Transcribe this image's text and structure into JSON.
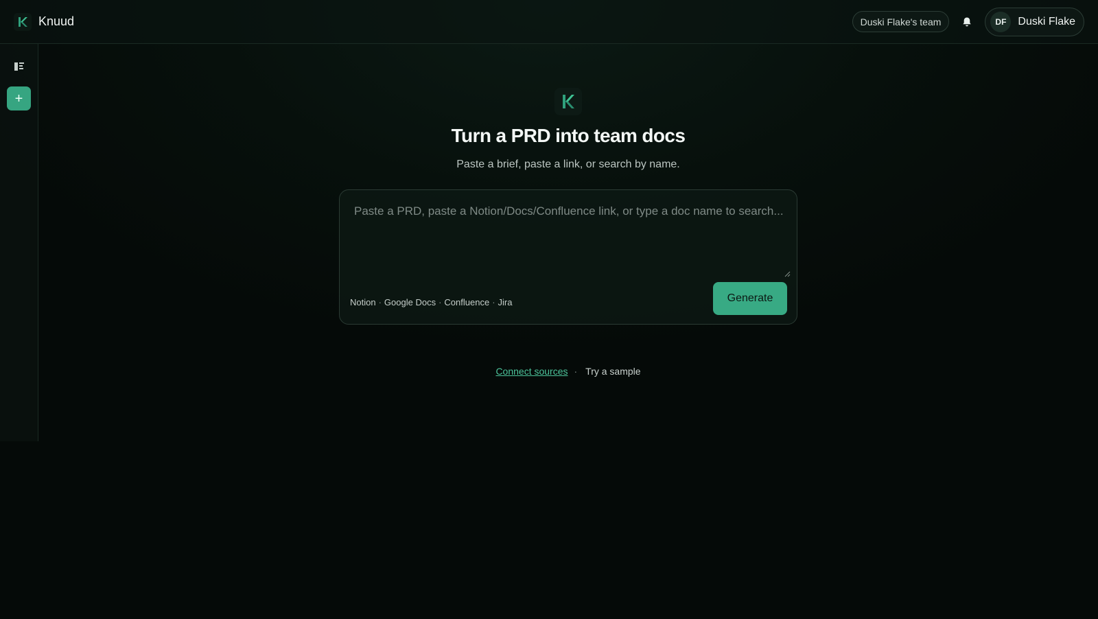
{
  "app": {
    "name": "Knuud"
  },
  "header": {
    "team_label": "Duski Flake's team",
    "user": {
      "initials": "DF",
      "name": "Duski Flake"
    }
  },
  "sidebar": {
    "new_label": "+"
  },
  "main": {
    "title": "Turn a PRD into team docs",
    "subtitle": "Paste a brief, paste a link, or search by name.",
    "input": {
      "value": "",
      "placeholder": "Paste a PRD, paste a Notion/Docs/Confluence link, or type a doc name to search..."
    },
    "sources": [
      "Notion",
      "Google Docs",
      "Confluence",
      "Jira"
    ],
    "source_separator": "·",
    "generate_label": "Generate",
    "links": {
      "connect": "Connect sources",
      "separator": "·",
      "sample": "Try a sample"
    }
  },
  "colors": {
    "accent": "#38aa84",
    "accent_link": "#4cc39a",
    "background": "#050a08"
  },
  "icons": {
    "logo": "knuud-logo-icon",
    "bell": "bell-icon",
    "sidebar_toggle": "sidebar-toggle-icon",
    "plus": "plus-icon"
  }
}
